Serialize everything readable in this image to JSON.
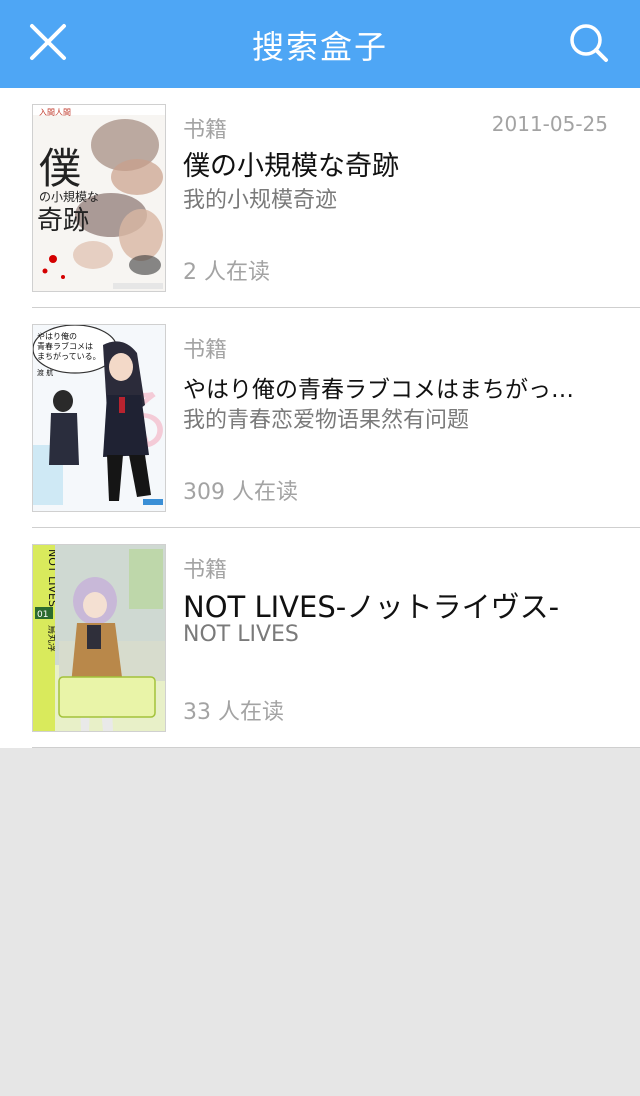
{
  "header": {
    "title": "搜索盒子",
    "close_icon": "close-icon",
    "search_icon": "search-icon",
    "bg_color": "#4ea6f5"
  },
  "results": [
    {
      "category": "书籍",
      "date": "2011-05-25",
      "title": "僕の小規模な奇跡",
      "subtitle": "我的小规模奇迹",
      "readers": "2 人在读",
      "cover": {
        "main_text": "僕",
        "sub_text": "の小規模な",
        "bottom_text": "奇跡",
        "top_label": "入間人間"
      }
    },
    {
      "category": "书籍",
      "date": "",
      "title": "やはり俺の青春ラブコメはまちがっ…",
      "subtitle": "我的青春恋爱物语果然有问题",
      "readers": "309 人在读",
      "cover": {
        "bubble_line1": "やはり俺の",
        "bubble_line2": "青春ラブコメは",
        "bubble_line3": "まちがっている。",
        "author": "渡 航"
      }
    },
    {
      "category": "书籍",
      "date": "",
      "title": "NOT LIVES-ノットライヴス-",
      "subtitle": "NOT LIVES",
      "readers": "33 人在读",
      "cover": {
        "side_text": "NOT LIVES",
        "volume": "01",
        "author": "烏丸浮"
      }
    }
  ]
}
